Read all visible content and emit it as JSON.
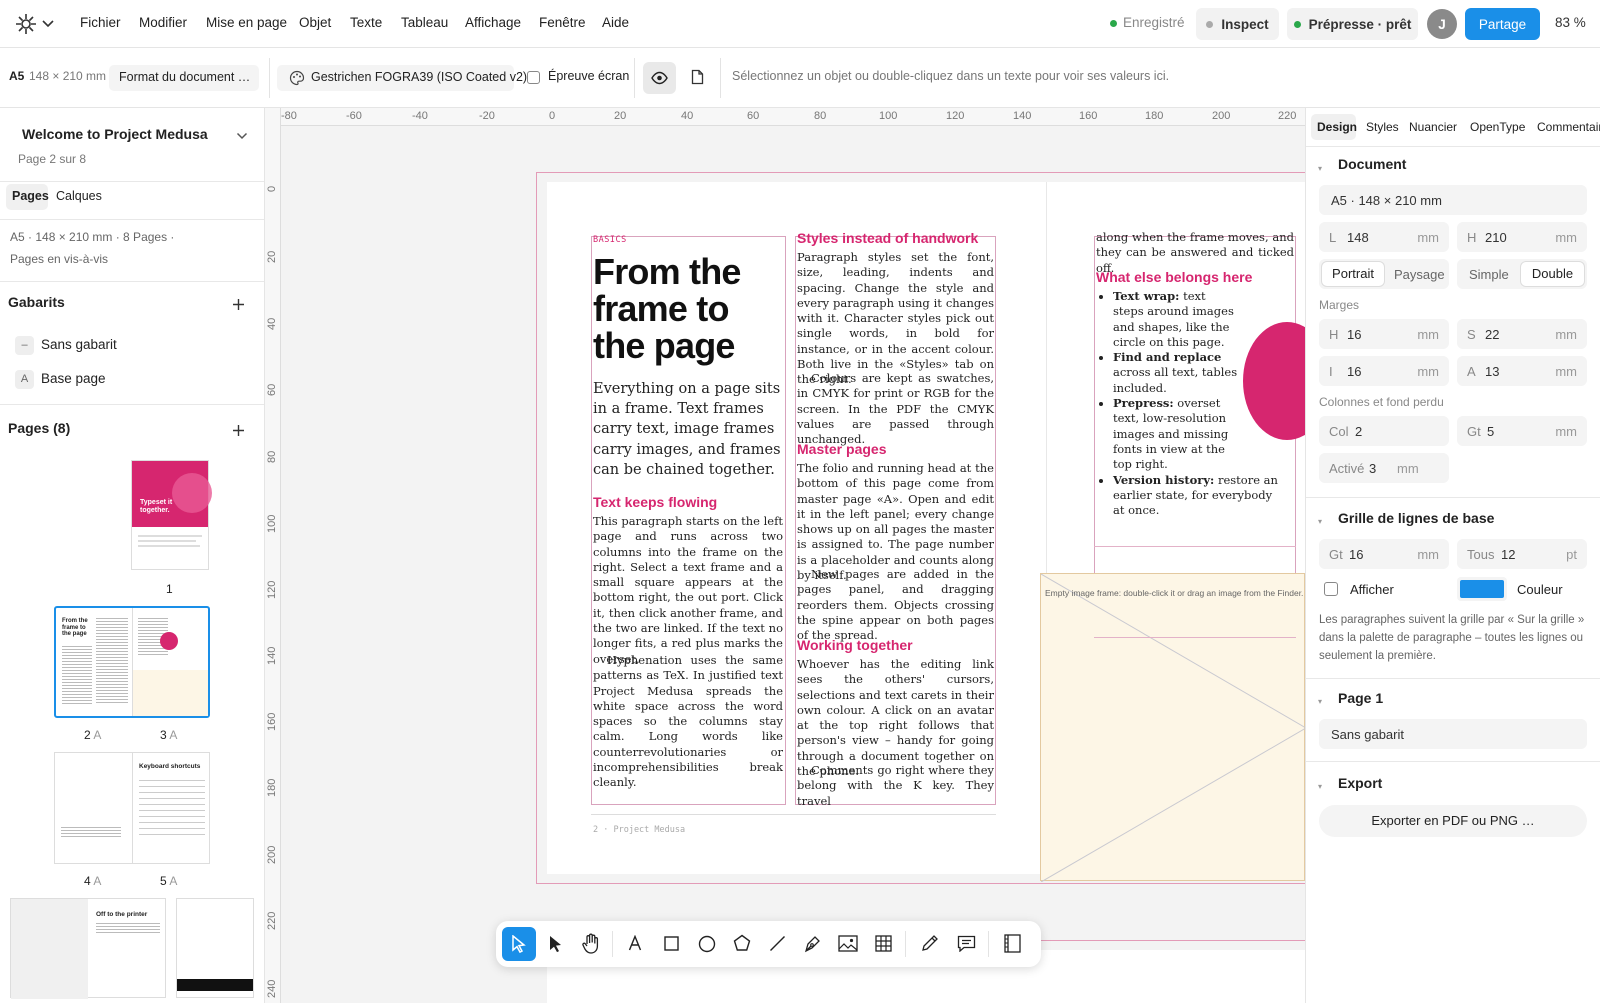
{
  "menubar": {
    "items": [
      "Fichier",
      "Modifier",
      "Mise en page",
      "Objet",
      "Texte",
      "Tableau",
      "Affichage",
      "Fenêtre",
      "Aide"
    ],
    "saved": "Enregistré",
    "inspect": "Inspect",
    "prepress": "Prépresse · prêt",
    "avatar": "J",
    "share": "Partage",
    "zoom": "83 %"
  },
  "toolbar": {
    "format_size": "A5",
    "format_dims": "148 × 210 mm",
    "format_button": "Format du document …",
    "profile": "Gestrichen FOGRA39 (ISO Coated v2)",
    "proof": "Épreuve écran",
    "hint": "Sélectionnez un objet ou double-cliquez dans un texte pour voir ses valeurs ici."
  },
  "left": {
    "doc_title": "Welcome to Project Medusa",
    "page_info": "Page 2 sur 8",
    "tab_pages": "Pages",
    "tab_layers": "Calques",
    "doc_meta1": "A5 · 148 × 210 mm · 8 Pages ·",
    "doc_meta2": "Pages en vis-à-vis",
    "masters_title": "Gabarits",
    "masters": [
      {
        "badge": "–",
        "label": "Sans gabarit"
      },
      {
        "badge": "A",
        "label": "Base page"
      }
    ],
    "pages_title": "Pages (8)",
    "thumb1_text": "Typeset it together.",
    "thumb2_text": "From the frame to the page",
    "thumb5_text": "Keyboard shortcuts",
    "thumb6_text": "Off to the printer",
    "labels": {
      "p1": "1",
      "p2": "2",
      "p3": "3",
      "p4": "4",
      "p5": "5",
      "master": "A"
    }
  },
  "canvas": {
    "ruler_top": [
      "-80",
      "-60",
      "-40",
      "-20",
      "0",
      "20",
      "40",
      "60",
      "80",
      "100",
      "120",
      "140",
      "160",
      "180",
      "200",
      "220"
    ],
    "ruler_left": [
      "0",
      "20",
      "40",
      "60",
      "80",
      "100",
      "120",
      "140",
      "160",
      "180",
      "200",
      "220",
      "240"
    ],
    "basics": "BASICS",
    "headline": "From the frame to the page",
    "intro": "Everything on a page sits in a frame. Text frames carry text, image frames carry images, and frames can be chained together.",
    "h_flowing": "Text keeps flowing",
    "p_flowing1": "This paragraph starts on the left page and runs across two columns into the frame on the right. Select a text frame and a small square appears at the bottom right, the out port. Click it, then click another frame, and the two are linked. If the text no longer fits, a red plus marks the overset.",
    "p_flowing2": "Hyphenation uses the same patterns as TeX. In justified text Project Medusa spreads the white space across the word spaces so the columns stay calm. Long words like counterrevolutionaries or incomprehensibilities break cleanly.",
    "h_styles": "Styles instead of handwork",
    "p_styles1": "Paragraph styles set the font, size, leading, indents and spacing. Change the style and every paragraph using it changes with it. Character styles pick out single words, in bold for instance, or in the accent colour. Both live in the «Styles» tab on the right.",
    "p_styles2": "Colours are kept as swatches, in CMYK for print or RGB for the screen. In the PDF the CMYK values are passed through unchanged.",
    "h_master": "Master pages",
    "p_master1": "The folio and running head at the bottom of this page come from master page «A». Open and edit it in the left panel; every change shows up on all pages the master is assigned to. The page number is a placeholder and counts along by itself.",
    "p_master2": "New pages are added in the pages panel, and dragging reorders them. Objects crossing the spine appear on both pages of the spread.",
    "h_together": "Working together",
    "p_together1": "Whoever has the editing link sees the others' cursors, selections and text carets in their own colour. A click on an avatar at the top right follows that person's view – handy for going through a document together on the phone.",
    "p_together2": "Comments go right where they belong with the K key. They travel",
    "folio": "2 · Project Medusa",
    "r_cont": "along when the frame moves, and they can be answered and ticked off.",
    "h_else": "What else belongs here",
    "bullets": [
      {
        "b": "Text wrap:",
        "t": " text steps around images and shapes, like the circle on this page."
      },
      {
        "b": "Find and replace",
        "t": " across all text, tables included."
      },
      {
        "b": "Prepress:",
        "t": " overset text, low-resolution images and missing fonts in view at the top right."
      },
      {
        "b": "Version history:",
        "t": " restore an earlier state, for everybody at once."
      }
    ],
    "img_hint": "Empty image frame: double-click it or drag an image from the Finder."
  },
  "right": {
    "tabs": [
      "Design",
      "Styles",
      "Nuancier",
      "OpenType",
      "Commentaires"
    ],
    "document": "Document",
    "format": "A5 · 148 × 210 mm",
    "w_label": "L",
    "w_val": "148",
    "h_label": "H",
    "h_val": "210",
    "unit_mm": "mm",
    "unit_pt": "pt",
    "portrait": "Portrait",
    "landscape": "Paysage",
    "single": "Simple",
    "double": "Double",
    "margins": "Marges",
    "m_top_l": "H",
    "m_top": "16",
    "m_out_l": "S",
    "m_out": "22",
    "m_in_l": "I",
    "m_in": "16",
    "m_bot_l": "A",
    "m_bot": "13",
    "columns_title": "Colonnes et fond perdu",
    "col_l": "Col",
    "col": "2",
    "gt_l": "Gt",
    "gt": "5",
    "bleed_l": "Activé",
    "bleed": "3",
    "baseline": "Grille de lignes de base",
    "bl_gt_l": "Gt",
    "bl_gt": "16",
    "bl_all_l": "Tous",
    "bl_all": "12",
    "show": "Afficher",
    "color": "Couleur",
    "baseline_note": "Les paragraphes suivent la grille par « Sur la grille » dans la palette de paragraphe – toutes les lignes ou seulement la première.",
    "page_section": "Page 1",
    "master_val": "Sans gabarit",
    "export": "Export",
    "export_btn": "Exporter en PDF ou PNG …"
  },
  "colors": {
    "accent": "#d6266f",
    "blue": "#1a8fe8",
    "green": "#2aa84a"
  },
  "icons": [
    "app-logo-icon",
    "chevron-down-icon",
    "palette-icon",
    "eye-icon",
    "page-icon",
    "plus-icon",
    "select-icon",
    "direct-select-icon",
    "hand-icon",
    "text-tool-icon",
    "rectangle-icon",
    "ellipse-icon",
    "polygon-icon",
    "line-icon",
    "pen-icon",
    "image-frame-icon",
    "table-icon",
    "pencil-icon",
    "comment-icon",
    "preview-icon"
  ]
}
